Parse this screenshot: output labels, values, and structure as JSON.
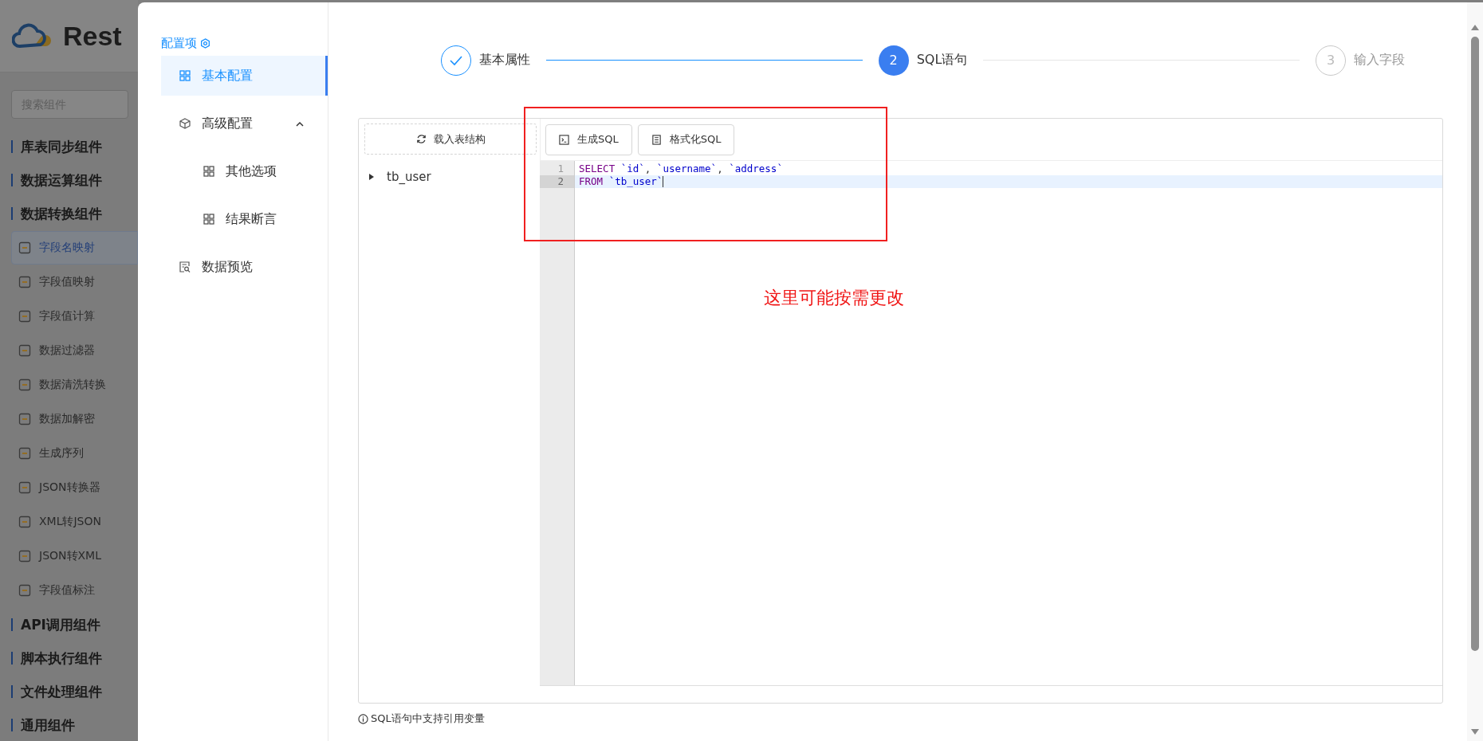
{
  "sidebar": {
    "logo_text": "Rest",
    "search": {
      "placeholder": "搜索组件"
    },
    "groups": [
      {
        "label": "库表同步组件"
      },
      {
        "label": "数据运算组件"
      },
      {
        "label": "数据转换组件",
        "items": [
          {
            "label": "字段名映射",
            "selected": true
          },
          {
            "label": "字段值映射",
            "selected": false
          },
          {
            "label": "字段值计算",
            "selected": false
          },
          {
            "label": "数据过滤器",
            "selected": false
          },
          {
            "label": "数据清洗转换",
            "selected": false
          },
          {
            "label": "数据加解密",
            "selected": false
          },
          {
            "label": "生成序列",
            "selected": false
          },
          {
            "label": "JSON转换器",
            "selected": false
          },
          {
            "label": "XML转JSON",
            "selected": false
          },
          {
            "label": "JSON转XML",
            "selected": false
          },
          {
            "label": "字段值标注",
            "selected": false
          }
        ]
      },
      {
        "label": "API调用组件"
      },
      {
        "label": "脚本执行组件"
      },
      {
        "label": "文件处理组件"
      },
      {
        "label": "通用组件"
      }
    ]
  },
  "drawer": {
    "title": "配置项",
    "nav": [
      {
        "label": "基本配置",
        "kind": "grid",
        "selected": true
      },
      {
        "label": "高级配置",
        "kind": "cube",
        "selected": false,
        "expanded": true,
        "children": [
          {
            "label": "其他选项",
            "kind": "grid",
            "selected": false
          },
          {
            "label": "结果断言",
            "kind": "grid",
            "selected": false
          }
        ]
      },
      {
        "label": "数据预览",
        "kind": "preview",
        "selected": false
      }
    ],
    "steps": [
      {
        "label": "基本属性",
        "done": true,
        "selected": false
      },
      {
        "number": "2",
        "label": "SQL语句",
        "done": false,
        "selected": true
      },
      {
        "number": "3",
        "label": "输入字段",
        "done": false,
        "selected": false
      }
    ],
    "load_button": "载入表结构",
    "tree": [
      {
        "label": "tb_user",
        "expanded": false
      }
    ],
    "toolbar": [
      {
        "label": "生成SQL",
        "kind": "terminal"
      },
      {
        "label": "格式化SQL",
        "kind": "format"
      }
    ],
    "code_lines": [
      {
        "number": "1",
        "selected": false,
        "tokens": [
          {
            "kind": "keyword",
            "text": "SELECT "
          },
          {
            "kind": "ident",
            "text": "`id`"
          },
          {
            "kind": "plain",
            "text": ", "
          },
          {
            "kind": "ident",
            "text": "`username`"
          },
          {
            "kind": "plain",
            "text": ", "
          },
          {
            "kind": "ident",
            "text": "`address`"
          }
        ]
      },
      {
        "number": "2",
        "selected": true,
        "tokens": [
          {
            "kind": "keyword",
            "text": "FROM "
          },
          {
            "kind": "ident",
            "text": "`tb_user`"
          }
        ]
      }
    ],
    "annotation": "这里可能按需更改",
    "hint": "SQL语句中支持引用变量"
  }
}
